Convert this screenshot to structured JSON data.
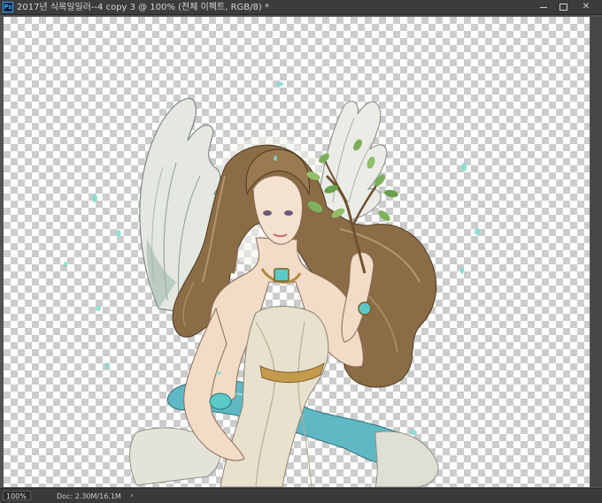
{
  "app": {
    "icon_label": "Ps"
  },
  "window": {
    "title": "2017년 식목일일러--4 copy 3 @ 100% (전체 이펙트, RGB/8) *",
    "controls": {
      "minimize": "minimize",
      "maximize": "maximize",
      "close": "✕"
    }
  },
  "status": {
    "zoom": "100%",
    "doc_info": "Doc: 2.30M/16.1M",
    "arrow": "›"
  },
  "canvas": {
    "transparency_grid": [
      "#ffffff",
      "#cccccc"
    ],
    "artwork_subject": "winged angel holding leafy branch"
  },
  "colors": {
    "chrome_bg": "#535353",
    "titlebar_bg": "#3c3c3c",
    "accent_teal": "#5cc9c9",
    "wing_white": "#e9ebe4",
    "hair_brown": "#8b6c45",
    "dress_cream": "#e8e0cc"
  }
}
